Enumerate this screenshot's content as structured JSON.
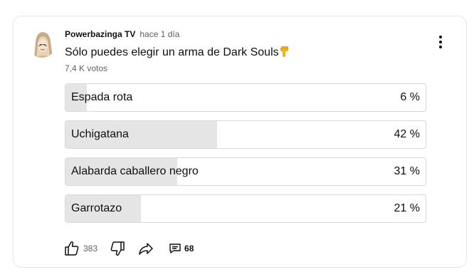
{
  "post": {
    "channel": "Powerbazinga TV",
    "time": "hace 1 día",
    "text": "Sólo puedes elegir un arma de Dark Souls",
    "votes": "7,4 K votos"
  },
  "poll": {
    "options": [
      {
        "label": "Espada rota",
        "percent_text": "6 %",
        "percent": 6
      },
      {
        "label": "Uchigatana",
        "percent_text": "42 %",
        "percent": 42
      },
      {
        "label": "Alabarda caballero negro",
        "percent_text": "31 %",
        "percent": 31
      },
      {
        "label": "Garrotazo",
        "percent_text": "21 %",
        "percent": 21
      }
    ]
  },
  "actions": {
    "likes": "383",
    "comments": "68"
  },
  "colors": {
    "fill": "#e5e5e5",
    "border": "#d9d9d9",
    "muted": "#606060"
  }
}
